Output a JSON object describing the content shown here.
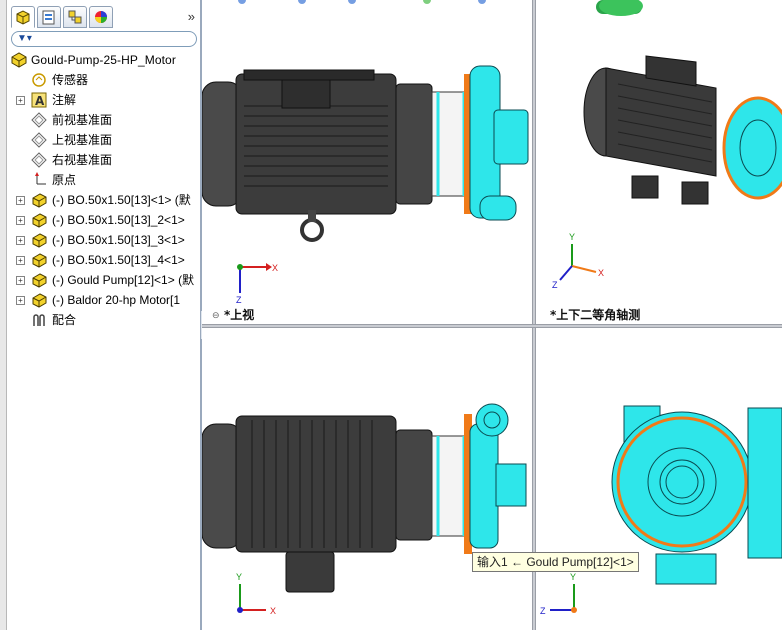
{
  "feature_tree": {
    "root_label": "Gould-Pump-25-HP_Motor",
    "items": [
      {
        "label": "传感器",
        "icon": "sensor-icon",
        "expandable": false
      },
      {
        "label": "注解",
        "icon": "annotation-icon",
        "expandable": true
      },
      {
        "label": "前视基准面",
        "icon": "plane-icon",
        "expandable": false
      },
      {
        "label": "上视基准面",
        "icon": "plane-icon",
        "expandable": false
      },
      {
        "label": "右视基准面",
        "icon": "plane-icon",
        "expandable": false
      },
      {
        "label": "原点",
        "icon": "origin-icon",
        "expandable": false
      },
      {
        "label": "(-) BO.50x1.50[13]<1> (默",
        "icon": "part-icon",
        "expandable": true
      },
      {
        "label": "(-) BO.50x1.50[13]_2<1>",
        "icon": "part-icon",
        "expandable": true
      },
      {
        "label": "(-) BO.50x1.50[13]_3<1>",
        "icon": "part-icon",
        "expandable": true
      },
      {
        "label": "(-) BO.50x1.50[13]_4<1>",
        "icon": "part-icon",
        "expandable": true
      },
      {
        "label": "(-) Gould Pump[12]<1> (默",
        "icon": "part-icon",
        "expandable": true
      },
      {
        "label": "(-) Baldor 20-hp Motor[1",
        "icon": "part-icon",
        "expandable": true
      },
      {
        "label": "配合",
        "icon": "mates-icon",
        "expandable": false
      }
    ]
  },
  "tabs": [
    "FeatureManager",
    "PropertyManager",
    "ConfigurationManager",
    "DisplayManager"
  ],
  "tabs_more": "»",
  "viewports": {
    "top_left_label": "*上视",
    "top_right_label": "*上下二等角轴测"
  },
  "tooltip": "输入1 ← Gould Pump[12]<1>",
  "colors": {
    "pump": "#2ee6ea",
    "motor": "#3a3a3a",
    "highlight": "#f07a18",
    "axis_x": "#d42020",
    "axis_y": "#1a9a1a",
    "axis_z": "#2020c8"
  }
}
